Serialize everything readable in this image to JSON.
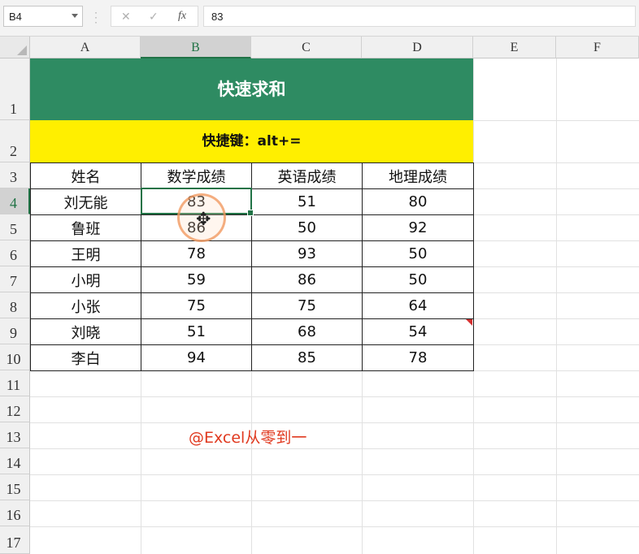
{
  "formula_bar": {
    "name_box": "B4",
    "cancel_icon": "✕",
    "enter_icon": "✓",
    "fx_label": "fx",
    "formula_value": "83"
  },
  "columns": [
    "A",
    "B",
    "C",
    "D",
    "E",
    "F"
  ],
  "rows": [
    "1",
    "2",
    "3",
    "4",
    "5",
    "6",
    "7",
    "8",
    "9",
    "10",
    "11",
    "12",
    "13",
    "14",
    "15",
    "16",
    "17"
  ],
  "selected_cell": "B4",
  "sheet": {
    "title": "快速求和",
    "subtitle": "快捷键：alt+=",
    "headers": [
      "姓名",
      "数学成绩",
      "英语成绩",
      "地理成绩"
    ],
    "records": [
      [
        "刘无能",
        "83",
        "51",
        "80"
      ],
      [
        "鲁班",
        "86",
        "50",
        "92"
      ],
      [
        "王明",
        "78",
        "93",
        "50"
      ],
      [
        "小明",
        "59",
        "86",
        "50"
      ],
      [
        "小张",
        "75",
        "75",
        "64"
      ],
      [
        "刘晓",
        "51",
        "68",
        "54"
      ],
      [
        "李白",
        "94",
        "85",
        "78"
      ]
    ],
    "watermark": "@Excel从零到一"
  },
  "colors": {
    "title_bg": "#2e8b62",
    "subtitle_bg": "#ffef00",
    "selection": "#217346",
    "watermark": "#e0391f"
  }
}
